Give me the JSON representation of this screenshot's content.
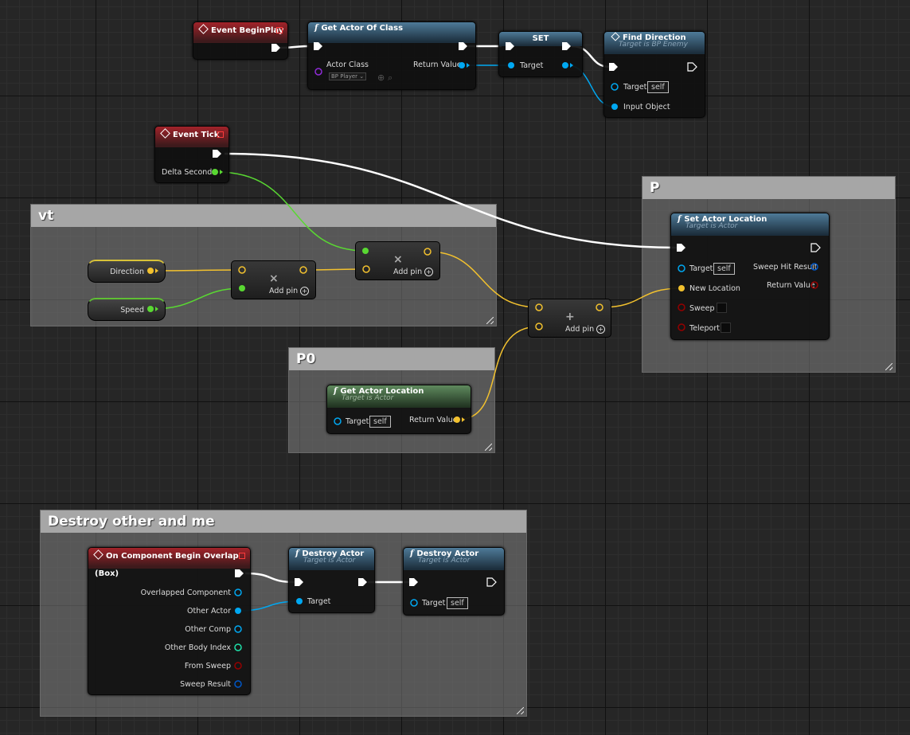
{
  "comments": {
    "vt": "vt",
    "p": "P",
    "p0": "P0",
    "destroy": "Destroy other and me"
  },
  "event_begin_play": {
    "title": "Event BeginPlay"
  },
  "get_actor_of_class": {
    "title": "Get Actor Of Class",
    "actor_class_label": "Actor Class",
    "actor_class_value": "BP Player",
    "return_value_label": "Return Value"
  },
  "set_node": {
    "title": "SET",
    "target_label": "Target"
  },
  "find_direction": {
    "title": "Find Direction",
    "subtitle": "Target is BP Enemy",
    "target_label": "Target",
    "target_value": "self",
    "input_object_label": "Input Object"
  },
  "event_tick": {
    "title": "Event Tick",
    "delta_seconds_label": "Delta Seconds"
  },
  "vars": {
    "direction": "Direction",
    "speed": "Speed"
  },
  "multiply_1": {
    "symbol": "×",
    "add_pin": "Add pin"
  },
  "multiply_2": {
    "symbol": "×",
    "add_pin": "Add pin"
  },
  "add_node": {
    "symbol": "+",
    "add_pin": "Add pin"
  },
  "set_actor_location": {
    "title": "Set Actor Location",
    "subtitle": "Target is Actor",
    "target_label": "Target",
    "target_value": "self",
    "sweep_hit_result_label": "Sweep Hit Result",
    "new_location_label": "New Location",
    "return_value_label": "Return Value",
    "sweep_label": "Sweep",
    "teleport_label": "Teleport"
  },
  "get_actor_location": {
    "title": "Get Actor Location",
    "subtitle": "Target is Actor",
    "target_label": "Target",
    "target_value": "self",
    "return_value_label": "Return Value"
  },
  "overlap_event": {
    "title": "On Component Begin Overlap (Box)",
    "pins": [
      "Overlapped Component",
      "Other Actor",
      "Other Comp",
      "Other Body Index",
      "From Sweep",
      "Sweep Result"
    ]
  },
  "destroy_actor_1": {
    "title": "Destroy Actor",
    "subtitle": "Target is Actor",
    "target_label": "Target"
  },
  "destroy_actor_2": {
    "title": "Destroy Actor",
    "subtitle": "Target is Actor",
    "target_label": "Target",
    "target_value": "self"
  },
  "colors": {
    "exec": "#ffffff",
    "object": "#00a8f2",
    "vector": "#f2c12e",
    "float": "#59d832",
    "bool": "#950000",
    "integer": "#1fe0a9",
    "struct": "#0057c8",
    "event_header": "#a2232a",
    "function_header": "#4e7a98",
    "pure_header": "#5f8a5e"
  }
}
